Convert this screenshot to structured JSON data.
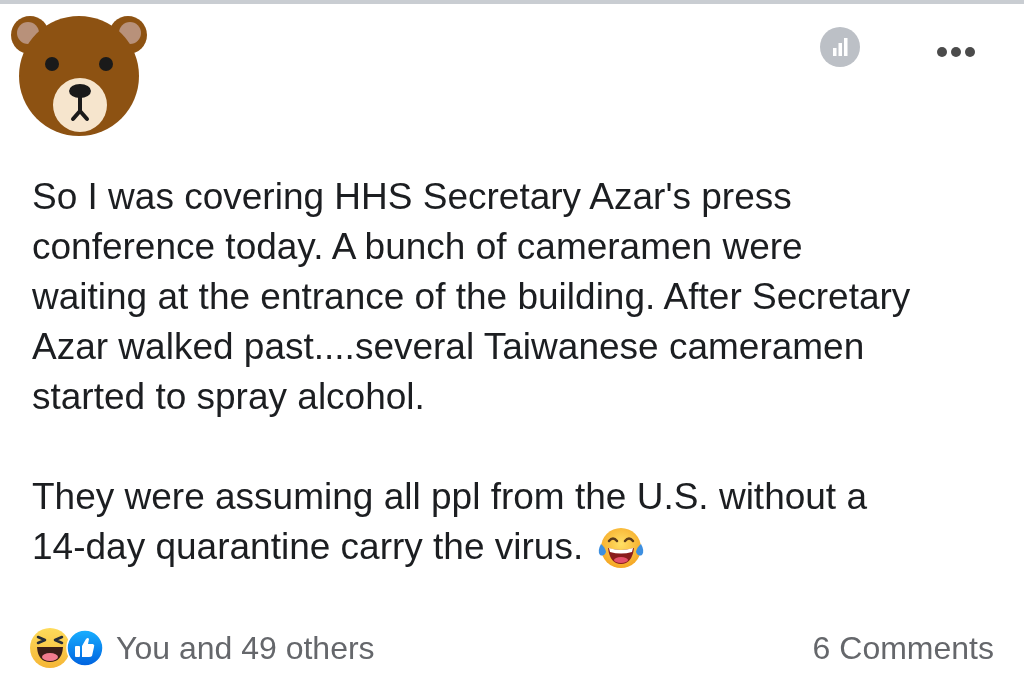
{
  "post": {
    "paragraphs": [
      {
        "text": "So I was covering HHS Secretary Azar's press conference today. A bunch of cameramen were waiting at the entrance of the building. After Secretary Azar walked past....several Taiwanese cameramen started to spray alcohol.",
        "ends_with_emoji": false
      },
      {
        "text": "They were assuming all ppl from the U.S. without a 14-day quarantine carry the virus.",
        "ends_with_emoji": true
      }
    ]
  },
  "footer": {
    "reactions_text": "You and 49 others",
    "comments": "6 Comments"
  }
}
